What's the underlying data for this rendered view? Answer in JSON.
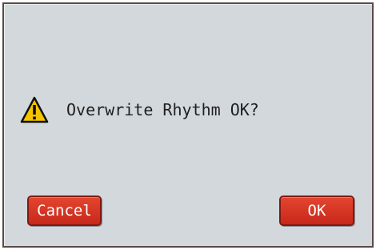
{
  "dialog": {
    "icon": "warning-icon",
    "message": "Overwrite Rhythm OK?",
    "cancel_label": "Cancel",
    "ok_label": "OK"
  },
  "colors": {
    "background": "#d3d8dd",
    "button": "#d4301f",
    "warning_fill": "#f5c400"
  }
}
